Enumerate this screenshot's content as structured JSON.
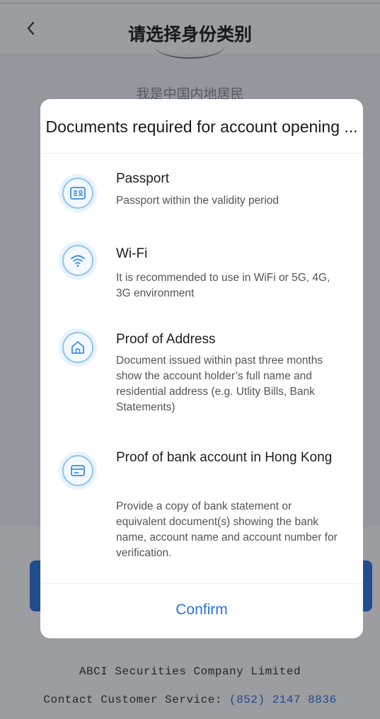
{
  "nav": {
    "title": "请选择身份类别",
    "back_icon": "chevron-left-icon"
  },
  "background": {
    "resident_label": "我是中国内地居民",
    "company": "ABCI Securities Company Limited",
    "contact_prefix": "Contact Customer Service: ",
    "phone": "(852) 2147 8836"
  },
  "dialog": {
    "title": "Documents required for account opening ...",
    "items": [
      {
        "icon": "passport-icon",
        "title": "Passport",
        "desc": "Passport within the validity period"
      },
      {
        "icon": "wifi-icon",
        "title": "Wi-Fi",
        "desc": "It is recommended to use in WiFi or 5G, 4G, 3G environment"
      },
      {
        "icon": "home-icon",
        "title": "Proof of Address",
        "desc": "Document issued within past three months show the account holder’s full name and residential address (e.g. Utlity Bills, Bank Statements)"
      },
      {
        "icon": "bank-card-icon",
        "title": "Proof of bank account in Hong Kong",
        "desc": "Provide a copy of bank statement or equivalent document(s) showing the bank name, account name and account number for verification."
      }
    ],
    "confirm_label": "Confirm"
  },
  "colors": {
    "accent": "#2b73d6",
    "icon_ring": "#8ec4f0",
    "icon_bg": "#e8f3fd"
  }
}
